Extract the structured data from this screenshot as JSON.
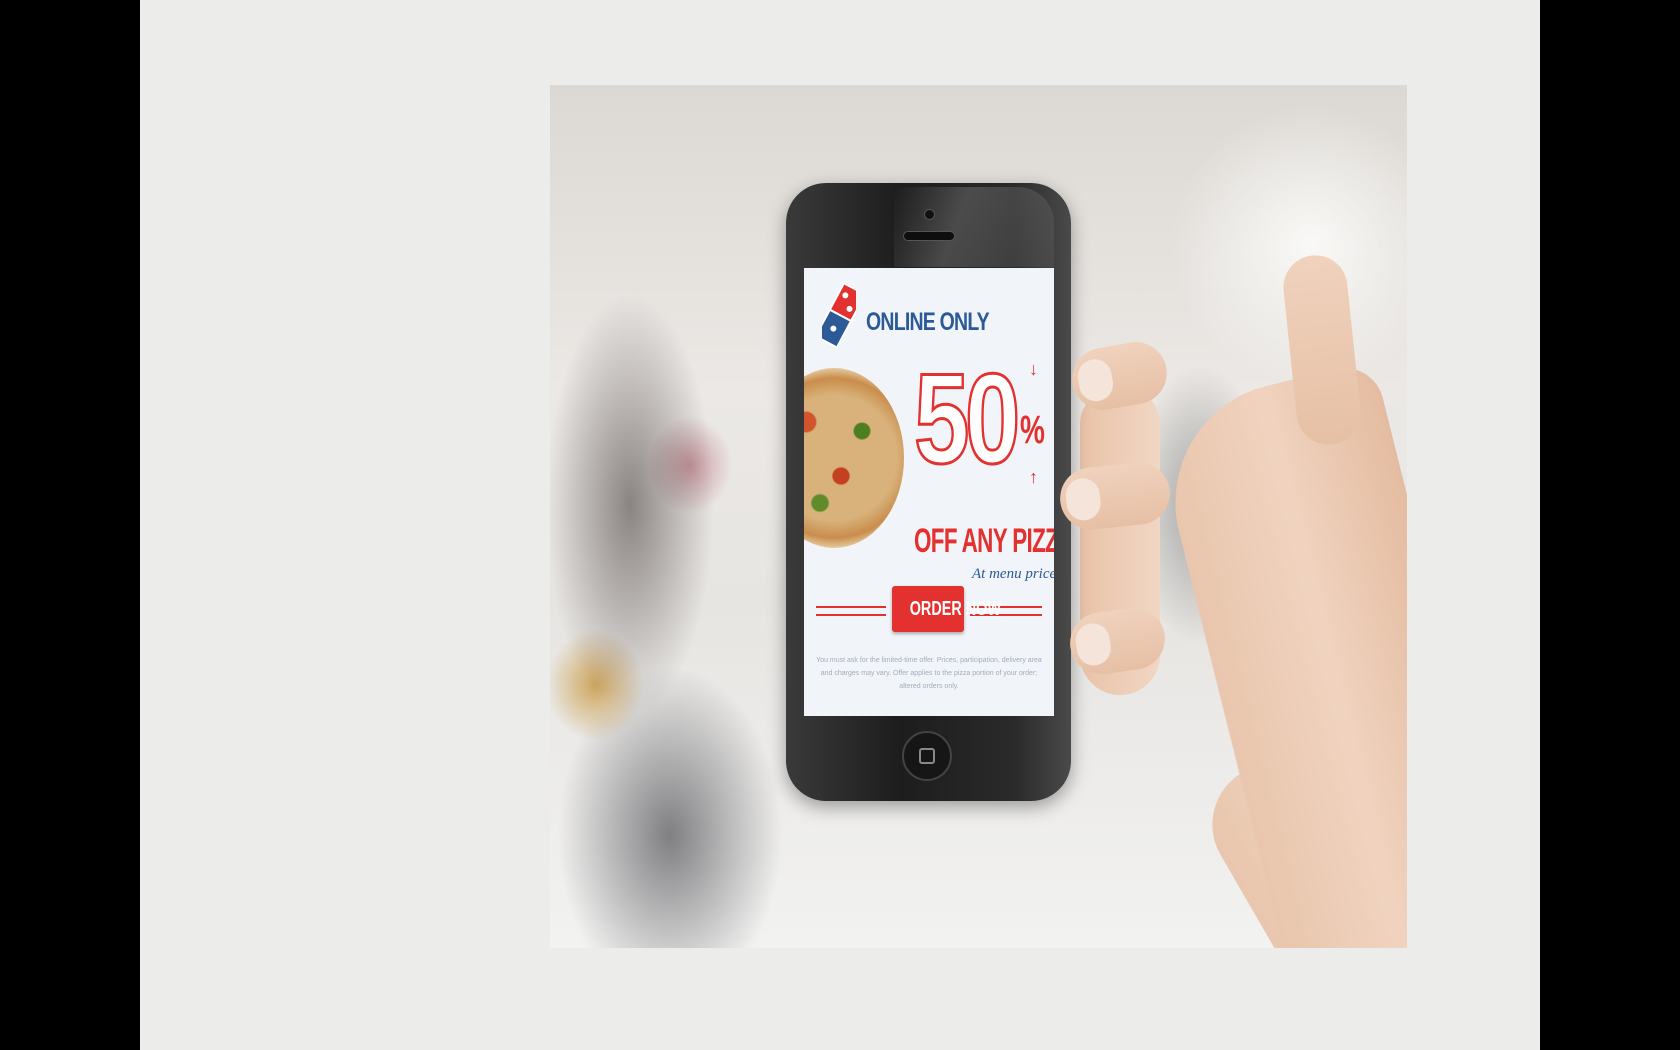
{
  "ad": {
    "headline": "ONLINE ONLY",
    "discount": "50",
    "percent_sign": "%",
    "offer": "OFF ANY PIZZA",
    "subtext": "At menu price",
    "cta_label": "ORDER NOW",
    "fine_print": "You must ask for the limited-time offer. Prices, participation, delivery area and charges may vary. Offer applies to the pizza portion of your order; altered orders only."
  },
  "colors": {
    "brand_red": "#e3312f",
    "brand_blue": "#2c5a97",
    "slide_bg": "#ececeb"
  },
  "icons": {
    "logo": "domino-tile-logo",
    "home": "home-button-icon"
  }
}
